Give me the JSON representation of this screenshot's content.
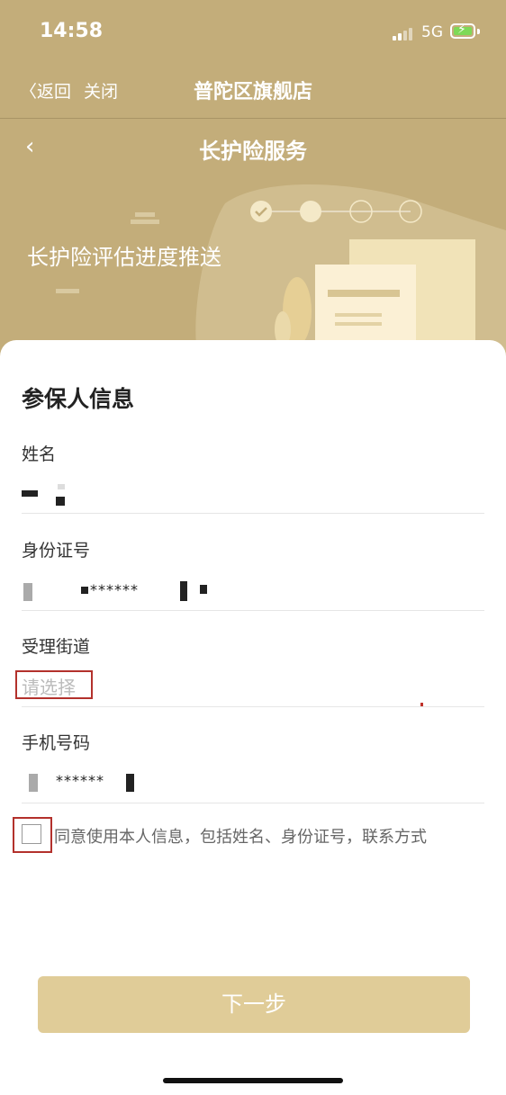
{
  "status": {
    "time": "14:58",
    "network": "5G"
  },
  "nav": {
    "back": "〈返回",
    "close": "关闭",
    "title": "普陀区旗舰店"
  },
  "subheader": {
    "back_icon": "‹",
    "title": "长护险服务"
  },
  "hero": {
    "text": "长护险评估进度推送"
  },
  "form": {
    "section_title": "参保人信息",
    "name_label": "姓名",
    "id_label": "身份证号",
    "id_masked": "******",
    "street_label": "受理街道",
    "street_placeholder": "请选择",
    "phone_label": "手机号码",
    "phone_masked": "******",
    "consent_text": "同意使用本人信息，包括姓名、身份证号，联系方式"
  },
  "actions": {
    "next": "下一步"
  },
  "colors": {
    "theme": "#c3ad7a",
    "button": "#e0cc98",
    "highlight": "#b3312c"
  }
}
